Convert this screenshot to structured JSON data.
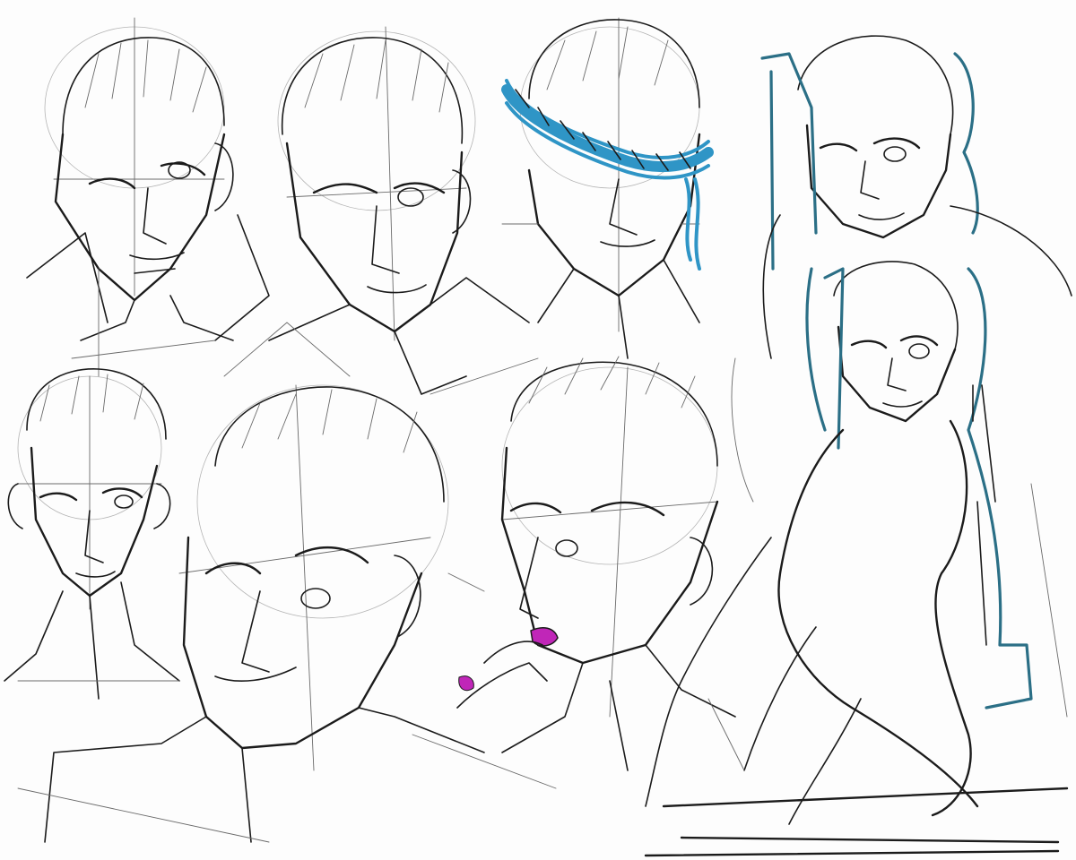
{
  "sheet": {
    "background_color": "#fdfdfd",
    "line_color": "#1b1b1b",
    "construction_line_color": "#b4b4b4",
    "headband_color": "#2f95c6",
    "hair_outline_color": "#2b6f86",
    "lip_color": "#c026b8"
  }
}
